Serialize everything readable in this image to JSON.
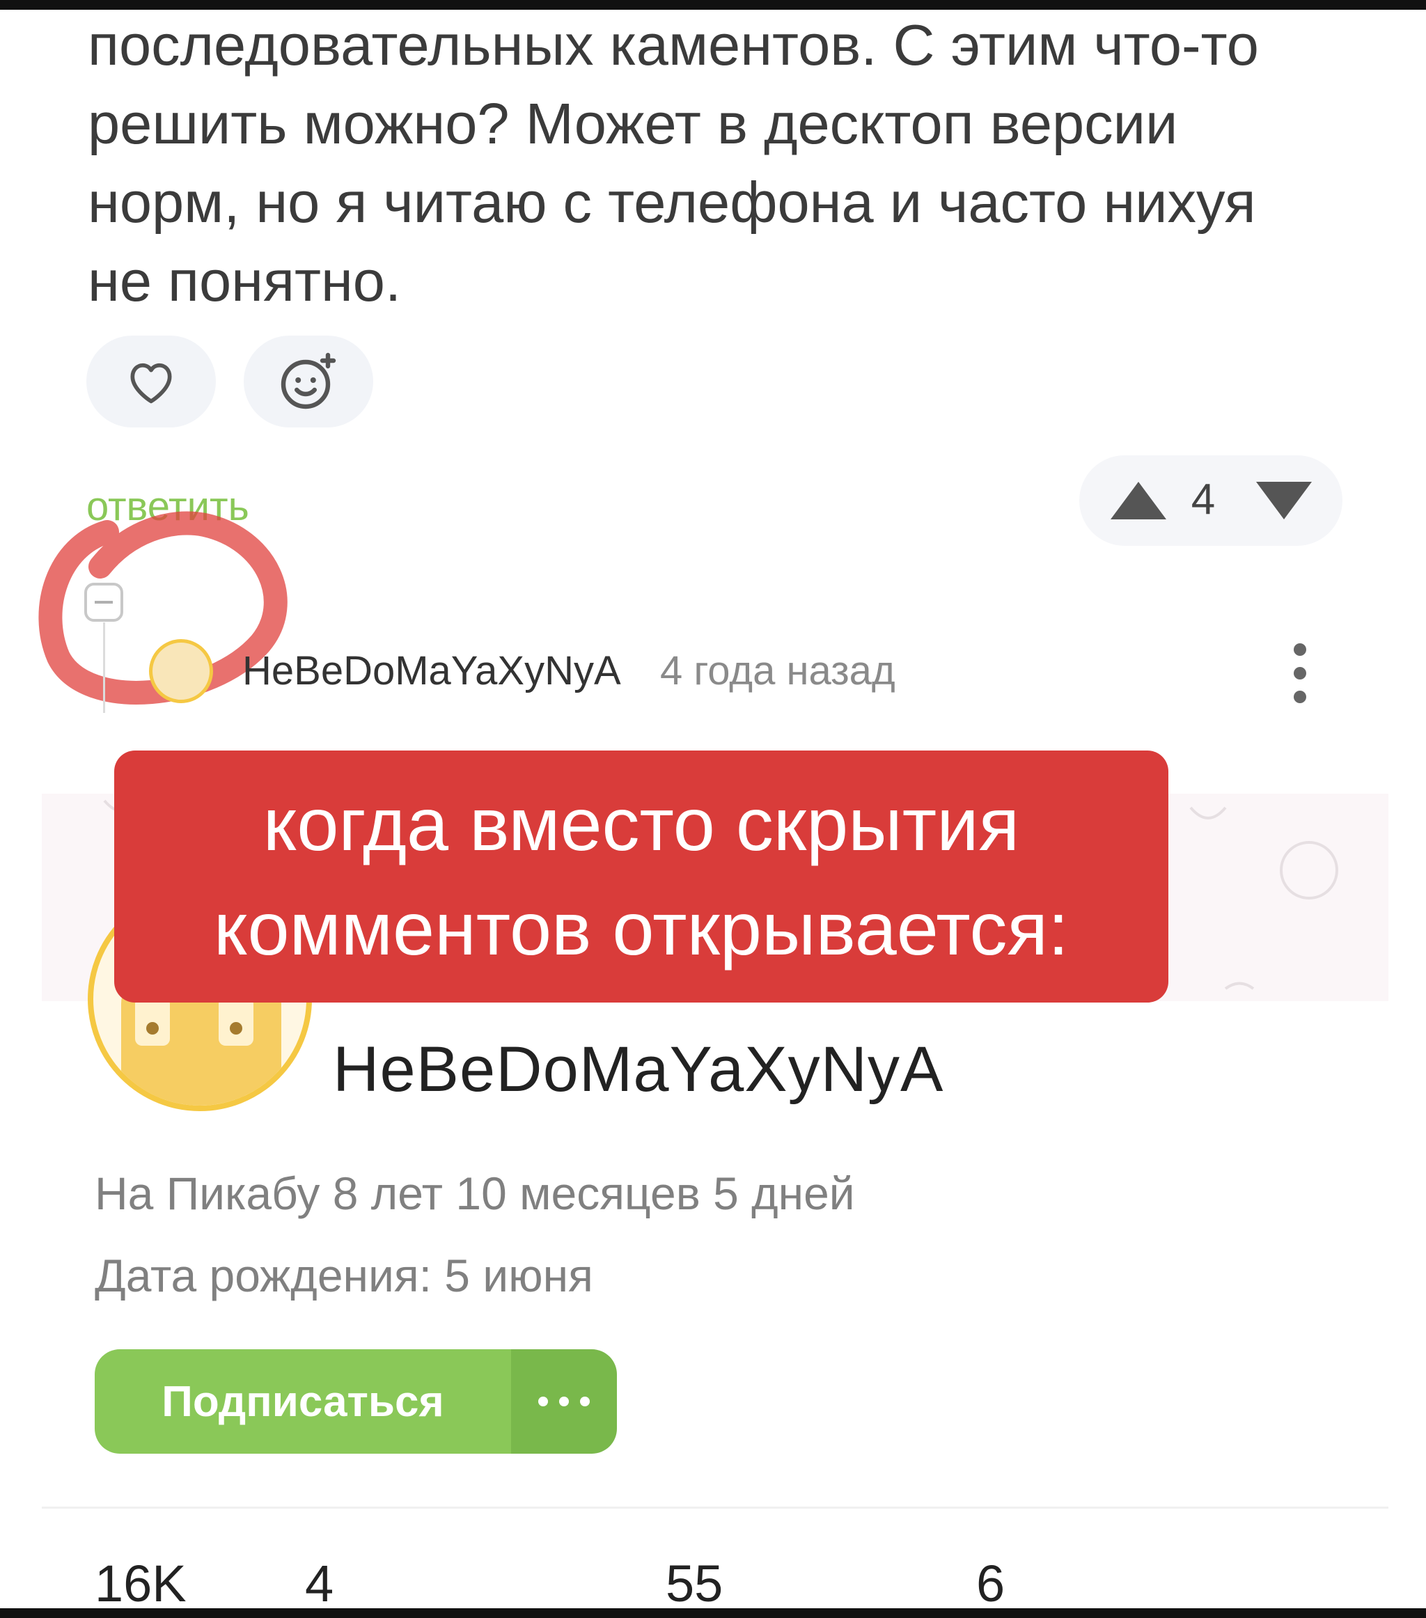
{
  "comment": {
    "lines": [
      "последовательных каментов. С этим что-то",
      "решить можно? Может в десктоп версии",
      "норм, но я читаю с телефона и часто нихуя",
      "не понятно."
    ],
    "like_icon": "heart-icon",
    "emoji_icon": "emoji-add-icon",
    "reply_label": "ответить",
    "rating": "4"
  },
  "thread": {
    "collapse_icon": "minus-square-icon",
    "author": "HeBeDoMaYaXyNyA",
    "time": "4 года назад",
    "menu_icon": "kebab-menu-icon"
  },
  "overlay": {
    "line1": "когда вместо скрытия",
    "line2": "комментов открывается:"
  },
  "profile": {
    "name": "HeBeDoMaYaXyNyA",
    "on_site": "На Пикабу 8 лет 10 месяцев 5 дней",
    "birthday": "Дата рождения: 5 июня",
    "subscribe_label": "Подписаться",
    "more_icon": "more-dots-icon"
  },
  "stats": [
    "16K",
    "4",
    "55",
    "6"
  ],
  "colors": {
    "accent_green": "#8ac858",
    "overlay_red": "#d93c3a",
    "avatar_ring": "#f5c843"
  }
}
